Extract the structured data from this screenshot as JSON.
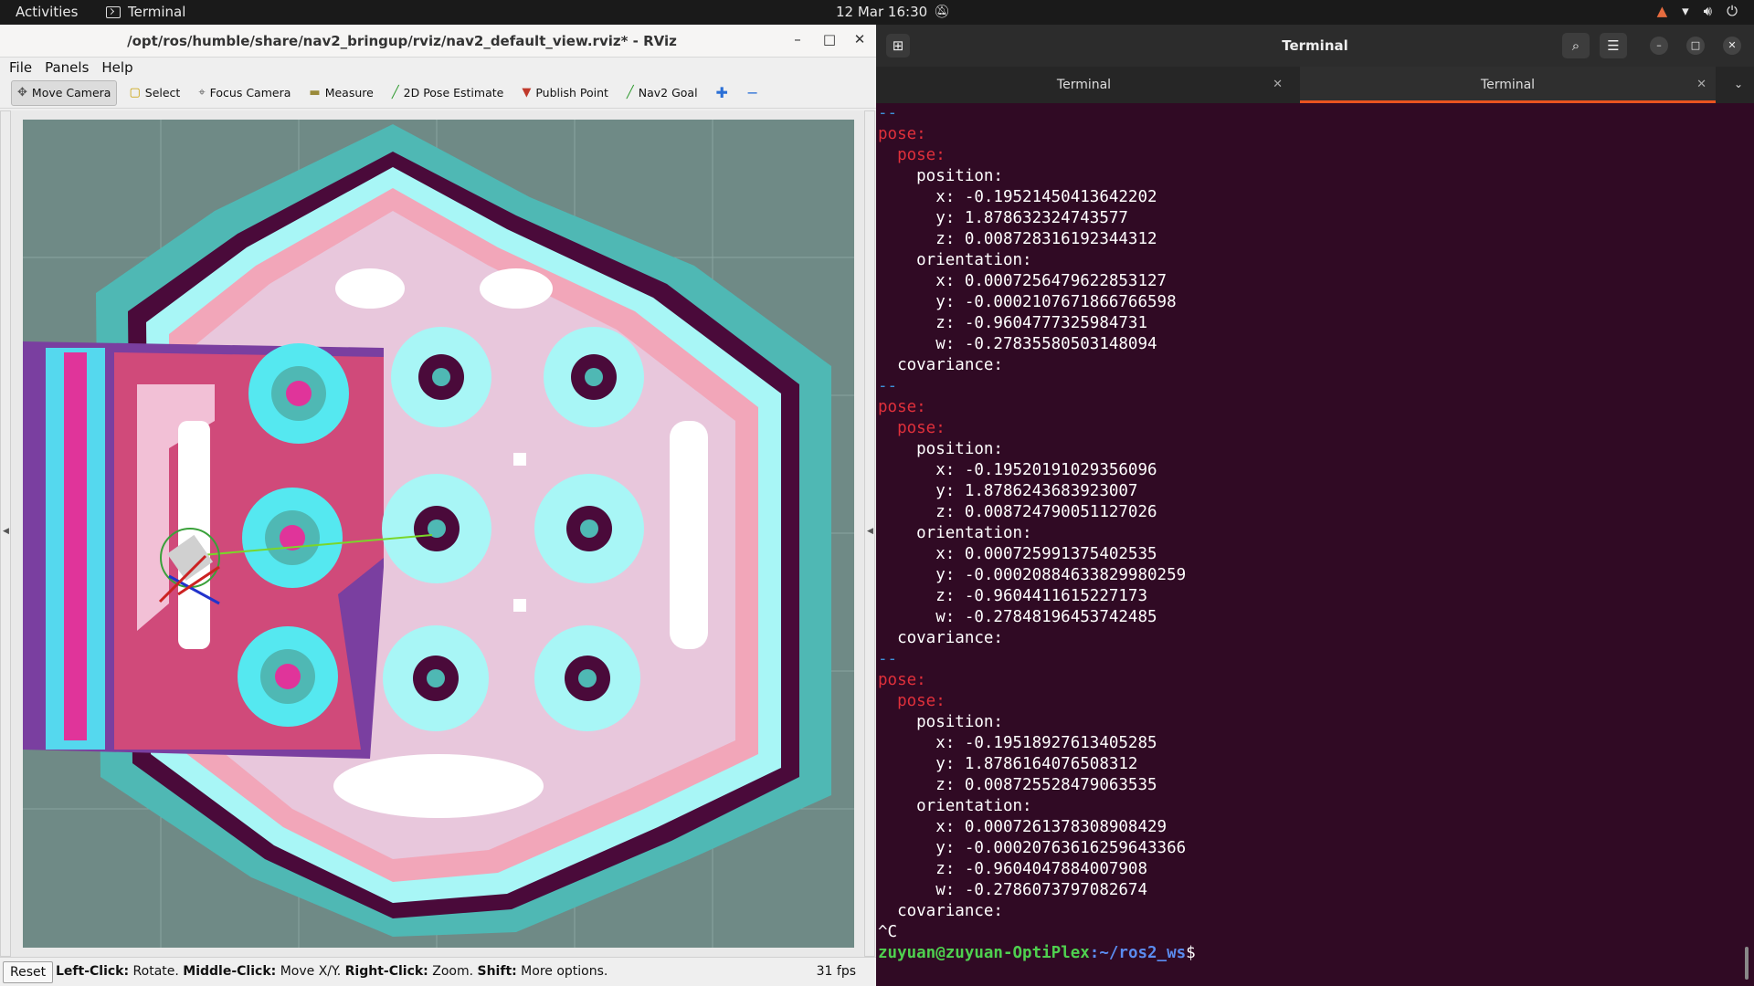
{
  "topbar": {
    "activities": "Activities",
    "app_name": "Terminal",
    "clock": "12 Mar  16:30"
  },
  "rviz": {
    "title": "/opt/ros/humble/share/nav2_bringup/rviz/nav2_default_view.rviz* - RViz",
    "menu": [
      "File",
      "Panels",
      "Help"
    ],
    "tools": [
      {
        "label": "Move Camera",
        "icon": "move-camera-icon",
        "active": true
      },
      {
        "label": "Select",
        "icon": "select-icon",
        "active": false
      },
      {
        "label": "Focus Camera",
        "icon": "focus-camera-icon",
        "active": false
      },
      {
        "label": "Measure",
        "icon": "measure-icon",
        "active": false
      },
      {
        "label": "2D Pose Estimate",
        "icon": "pose-estimate-icon",
        "active": false
      },
      {
        "label": "Publish Point",
        "icon": "publish-point-icon",
        "active": false
      },
      {
        "label": "Nav2 Goal",
        "icon": "nav2-goal-icon",
        "active": false
      }
    ],
    "status": {
      "reset_label": "Reset",
      "hint_parts": [
        {
          "b": "Left-Click:",
          "t": " Rotate. "
        },
        {
          "b": "Middle-Click:",
          "t": " Move X/Y. "
        },
        {
          "b": "Right-Click:",
          "t": " Zoom. "
        },
        {
          "b": "Shift:",
          "t": " More options."
        }
      ],
      "fps": "31 fps"
    }
  },
  "terminal": {
    "title": "Terminal",
    "tabs": [
      "Terminal",
      "Terminal"
    ],
    "blocks": [
      {
        "position": [
          "-0.19521450413642202",
          "1.878632324743577",
          "0.008728316192344312"
        ],
        "orientation": [
          "0.0007256479622853127",
          "-0.0002107671866766598",
          "-0.9604777325984731",
          "-0.27835580503148094"
        ]
      },
      {
        "position": [
          "-0.19520191029356096",
          "1.8786243683923007",
          "0.008724790051127026"
        ],
        "orientation": [
          "0.000725991375402535",
          "-0.00020884633829980259",
          "-0.9604411615227173",
          "-0.27848196453742485"
        ]
      },
      {
        "position": [
          "-0.19518927613405285",
          "1.8786164076508312",
          "0.008725528479063535"
        ],
        "orientation": [
          "0.0007261378308908429",
          "-0.00020763616259643366",
          "-0.9604047884007908",
          "-0.2786073797082674"
        ]
      }
    ],
    "interrupt": "^C",
    "prompt_user": "zuyuan@zuyuan-OptiPlex",
    "prompt_path": ":~/ros2_ws",
    "prompt_end": "$"
  },
  "colors": {
    "terminal_bg": "#300a24",
    "key_red": "#e0303b",
    "map_bg": "#6f8a86",
    "cost_teal": "#4fb8b4",
    "cost_cyan": "#a8f6f6",
    "cost_pink": "#f2a6b9",
    "cost_lavender": "#d7aed6",
    "obstacle": "#4a0a3a",
    "local_cost_purple": "#7a3fa0",
    "local_cost_magenta": "#e0349a",
    "accent_orange": "#e95420"
  }
}
